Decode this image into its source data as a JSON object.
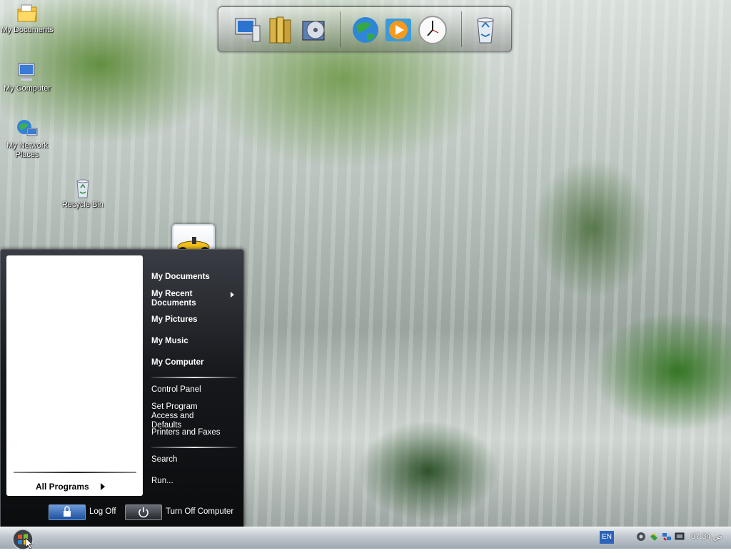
{
  "desktop": {
    "icons": [
      {
        "label": "My Documents"
      },
      {
        "label": "My Computer"
      },
      {
        "label": "My Network Places"
      },
      {
        "label": "Recycle Bin"
      }
    ]
  },
  "dock": {
    "items": [
      "computer-icon",
      "library-icon",
      "dvd-icon",
      "globe-icon",
      "media-player-icon",
      "clock-icon",
      "recycle-bin-icon"
    ]
  },
  "start_menu": {
    "all_programs": "All Programs",
    "right_items": {
      "my_documents": "My Documents",
      "my_recent_documents": "My Recent Documents",
      "my_pictures": "My Pictures",
      "my_music": "My Music",
      "my_computer": "My Computer",
      "control_panel": "Control Panel",
      "set_program_access": "Set Program Access and Defaults",
      "printers_faxes": "Printers and Faxes",
      "search": "Search",
      "run": "Run..."
    },
    "log_off": "Log Off",
    "turn_off": "Turn Off Computer"
  },
  "taskbar": {
    "language": "EN",
    "clock": "07:34 ص"
  }
}
